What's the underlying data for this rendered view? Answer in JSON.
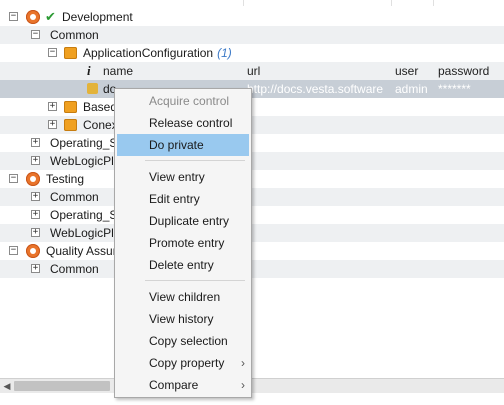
{
  "tree": {
    "rows": [
      {
        "id": "dev",
        "label": "Development",
        "toggle": "−"
      },
      {
        "id": "common",
        "label": "Common",
        "toggle": "−"
      },
      {
        "id": "appconf",
        "label": "ApplicationConfiguration",
        "count": "(1)",
        "toggle": "−"
      },
      {
        "id": "header",
        "info": "i",
        "cols": [
          "name",
          "url",
          "user",
          "password"
        ]
      },
      {
        "id": "entry",
        "name": "do",
        "url": "http://docs.vesta.software",
        "user": "admin",
        "password": "*******"
      },
      {
        "id": "based",
        "label": "Based",
        "toggle": "+"
      },
      {
        "id": "conex",
        "label": "Conex",
        "toggle": "+"
      },
      {
        "id": "opsys1",
        "label": "Operating_S",
        "toggle": "+"
      },
      {
        "id": "weblogic1",
        "label": "WebLogicPl",
        "toggle": "+"
      },
      {
        "id": "testing",
        "label": "Testing",
        "toggle": "−"
      },
      {
        "id": "common2",
        "label": "Common",
        "toggle": "+"
      },
      {
        "id": "opsys2",
        "label": "Operating_S",
        "toggle": "+"
      },
      {
        "id": "weblogic2",
        "label": "WebLogicPl",
        "toggle": "+"
      },
      {
        "id": "qa",
        "label": "Quality Assur",
        "toggle": "−"
      },
      {
        "id": "common3",
        "label": "Common",
        "toggle": "+"
      }
    ]
  },
  "context_menu": {
    "items": [
      {
        "label": "Acquire control",
        "disabled": true
      },
      {
        "label": "Release control"
      },
      {
        "label": "Do private",
        "highlighted": true
      },
      {
        "label": "View entry"
      },
      {
        "label": "Edit entry"
      },
      {
        "label": "Duplicate entry"
      },
      {
        "label": "Promote entry"
      },
      {
        "label": "Delete entry"
      },
      {
        "label": "View children"
      },
      {
        "label": "View history"
      },
      {
        "label": "Copy selection"
      },
      {
        "label": "Copy property",
        "submenu": "›"
      },
      {
        "label": "Compare",
        "submenu": "›"
      }
    ]
  },
  "scrollbar": {
    "left_arrow": "◀"
  },
  "colors": {
    "highlight": "#99c9ef",
    "selected_row": "#c7ced6",
    "accent_count": "#3d7ac7",
    "gear": "#e9742b",
    "cube": "#f0a020",
    "check": "#2b9a33"
  }
}
